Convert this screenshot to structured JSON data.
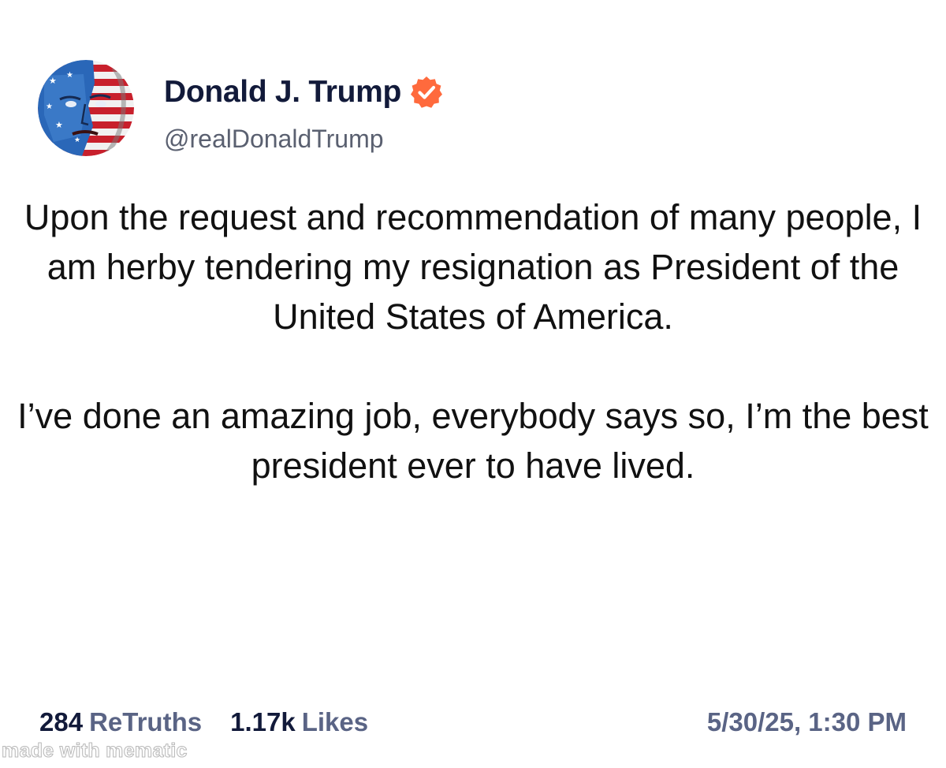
{
  "author": {
    "display_name": "Donald J. Trump",
    "handle": "@realDonaldTrump",
    "verified_icon": "verified-badge-icon",
    "badge_color": "#ff6a3d"
  },
  "post": {
    "paragraphs": [
      "Upon the request and recommendation of many people, I am herby tendering my resignation as President of the United States of America.",
      "I’ve done an amazing job, everybody says so, I’m the best president ever to have lived."
    ]
  },
  "stats": {
    "retruths_count": "284",
    "retruths_label": "ReTruths",
    "likes_count": "1.17k",
    "likes_label": "Likes",
    "timestamp": "5/30/25, 1:30 PM"
  },
  "watermark": "made with mematic"
}
